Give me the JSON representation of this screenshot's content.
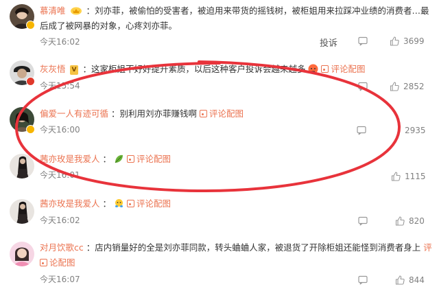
{
  "comments": [
    {
      "user": "慕清唯",
      "text_line1": "：刘亦菲，被偷怕的受害者，被迫用来带货的摇钱树，被柜姐用来拉踩冲业绩的消费者…最",
      "text_line2": "后成了被网暴的对象，心疼刘亦菲。",
      "time": "今天16:02",
      "report": "投诉",
      "likes": "3699"
    },
    {
      "user": "灰灰悟",
      "level": "V",
      "text": "：这家柜姐不好好提升素质，以后这种客户投诉会越来越多",
      "pic_label": "评论配图",
      "time": "今天15:54",
      "likes": "2852"
    },
    {
      "user": "偏爱一人有迹可循",
      "text": "：别利用刘亦菲赚钱啊",
      "pic_label": "评论配图",
      "time": "今天16:00",
      "likes": "2935"
    },
    {
      "user": "茜亦玫是我爱人",
      "text": "：",
      "pic_label": "评论配图",
      "time": "今天16:01",
      "likes": "1115"
    },
    {
      "user": "茜亦玫是我爱人",
      "text": "：",
      "pic_label": "评论配图",
      "time": "今天16:02",
      "likes": "820"
    },
    {
      "user": "对月饮歌cc",
      "text_line1": "：店内销量好的全是刘亦菲同款，转头蛐蛐人家，被退货了开除柜姐还能怪到消费者身上",
      "pic_label_part1": "评",
      "pic_label_part2": "论配图",
      "time": "今天16:07",
      "likes": "844"
    }
  ],
  "icons": {
    "share": "share-icon",
    "comment": "comment-icon",
    "like": "thumb-up-icon"
  },
  "colors": {
    "username": "#eb7350",
    "annotation_oval": "#e8333b"
  }
}
